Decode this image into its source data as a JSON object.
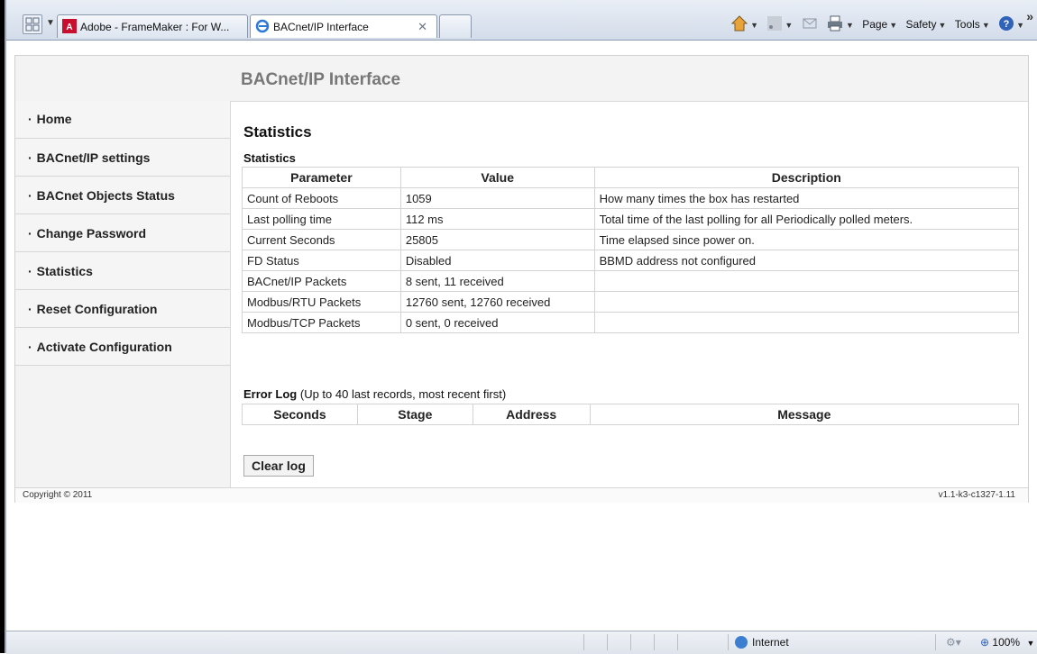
{
  "browser": {
    "tabs": [
      {
        "label": "Adobe - FrameMaker : For W...",
        "active": false
      },
      {
        "label": "BACnet/IP Interface",
        "active": true
      }
    ],
    "commands": [
      "Page",
      "Safety",
      "Tools"
    ]
  },
  "page": {
    "header_title": "BACnet/IP Interface",
    "sidebar": [
      {
        "label": "Home"
      },
      {
        "label": "BACnet/IP settings"
      },
      {
        "label": "BACnet Objects Status"
      },
      {
        "label": "Change Password"
      },
      {
        "label": "Statistics"
      },
      {
        "label": "Reset Configuration"
      },
      {
        "label": "Activate Configuration"
      }
    ],
    "title": "Statistics",
    "stats_subtitle": "Statistics",
    "stats_columns": [
      "Parameter",
      "Value",
      "Description"
    ],
    "stats_rows": [
      {
        "parameter": "Count of Reboots",
        "value": "1059",
        "description": "How many times the box has restarted"
      },
      {
        "parameter": "Last polling time",
        "value": "112 ms",
        "description": "Total time of the last polling for all Periodically polled meters."
      },
      {
        "parameter": "Current Seconds",
        "value": "25805",
        "description": "Time elapsed since power on."
      },
      {
        "parameter": "FD Status",
        "value": "Disabled",
        "description": "BBMD address not configured"
      },
      {
        "parameter": "BACnet/IP Packets",
        "value": "8 sent, 11 received",
        "description": ""
      },
      {
        "parameter": "Modbus/RTU Packets",
        "value": "12760 sent, 12760 received",
        "description": ""
      },
      {
        "parameter": "Modbus/TCP Packets",
        "value": "0 sent, 0 received",
        "description": ""
      }
    ],
    "error_log": {
      "title": "Error Log",
      "note": "(Up to 40 last records, most recent first)",
      "columns": [
        "Seconds",
        "Stage",
        "Address",
        "Message"
      ]
    },
    "clear_button": "Clear log",
    "footer": {
      "copyright": "Copyright © 2011",
      "version": "v1.1-k3-c1327-1.11"
    }
  },
  "statusbar": {
    "zone": "Internet",
    "zoom": "100%"
  }
}
